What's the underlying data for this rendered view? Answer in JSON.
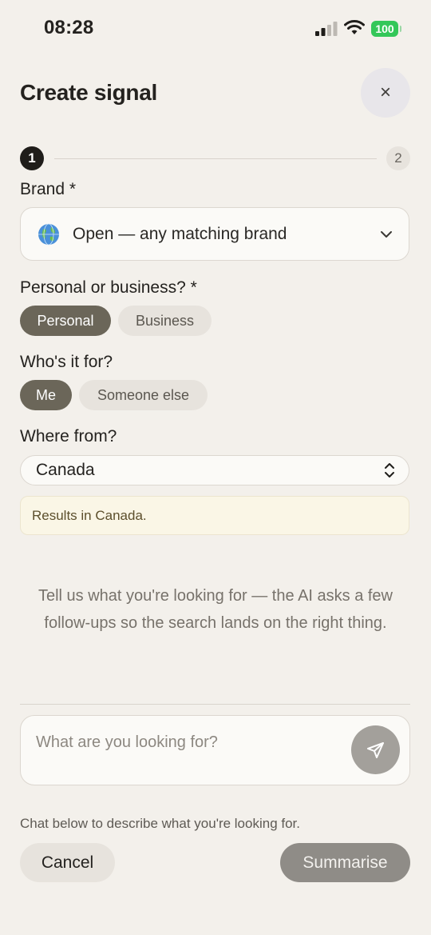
{
  "status_bar": {
    "time": "08:28",
    "battery": "100"
  },
  "header": {
    "title": "Create signal",
    "close_label": "×"
  },
  "stepper": {
    "step1": "1",
    "step2": "2"
  },
  "brand": {
    "label": "Brand *",
    "value": "Open — any matching brand"
  },
  "personal_business": {
    "label": "Personal or business? *",
    "options": [
      "Personal",
      "Business"
    ],
    "selected": "Personal"
  },
  "who_for": {
    "label": "Who's it for?",
    "options": [
      "Me",
      "Someone else"
    ],
    "selected": "Me"
  },
  "where_from": {
    "label": "Where from?",
    "value": "Canada",
    "notice": "Results in Canada."
  },
  "intro_text": "Tell us what you're looking for — the AI asks a few follow-ups so the search lands on the right thing.",
  "chat": {
    "placeholder": "What are you looking for?"
  },
  "footer": {
    "hint": "Chat below to describe what you're looking for.",
    "cancel_label": "Cancel",
    "summarise_label": "Summarise"
  },
  "colors": {
    "background": "#f3f0eb",
    "pill_active": "#6b6659",
    "battery": "#34c759",
    "notice_bg": "#faf6e6"
  }
}
